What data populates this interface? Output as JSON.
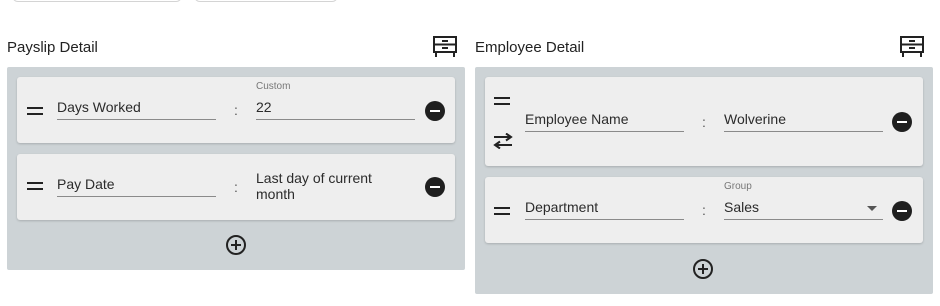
{
  "payslip": {
    "title": "Payslip Detail",
    "rows": [
      {
        "label": "Days Worked",
        "separator": ":",
        "value_type": "Custom",
        "value": "22"
      },
      {
        "label": "Pay Date",
        "separator": ":",
        "value": "Last day of current month"
      }
    ]
  },
  "employee": {
    "title": "Employee Detail",
    "rows": [
      {
        "label": "Employee Name",
        "separator": ":",
        "value": "Wolverine"
      },
      {
        "label": "Department",
        "separator": ":",
        "value_type": "Group",
        "value": "Sales"
      }
    ]
  },
  "icons": {
    "drawer": "drawer-icon",
    "drag": "drag-handle-icon",
    "swap": "swap-icon",
    "remove": "remove-circle-icon",
    "add": "add-circle-icon",
    "dropdown": "chevron-down-icon"
  },
  "colors": {
    "panel_bg": "#cdd3d6",
    "card_bg": "#eeeeee"
  }
}
